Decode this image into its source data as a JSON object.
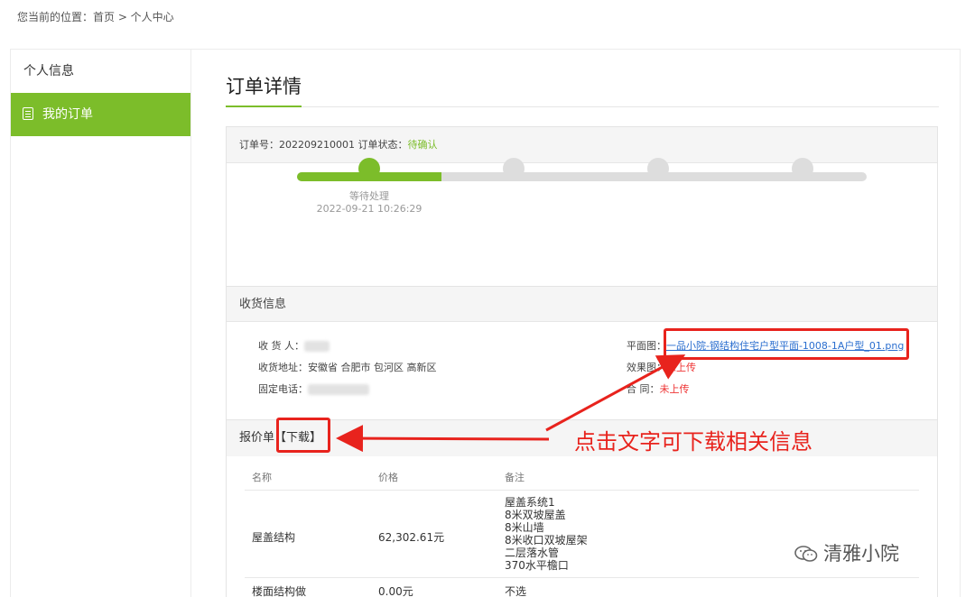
{
  "breadcrumb": "您当前的位置：首页 > 个人中心",
  "sidebar": {
    "items": [
      {
        "label": "个人信息",
        "active": false
      },
      {
        "label": "我的订单",
        "active": true
      }
    ]
  },
  "main": {
    "title": "订单详情"
  },
  "order": {
    "number_label": "订单号：202209210001  订单状态：",
    "status": "待确认",
    "progress": {
      "current_step": 1,
      "total_steps": 5,
      "step_label": "等待处理",
      "step_time": "2022-09-21 10:26:29"
    }
  },
  "delivery": {
    "title": "收货信息",
    "receiver_label": "收 货 人：",
    "address_label": "收货地址：",
    "address": "安徽省 合肥市 包河区 高新区",
    "phone_label": "固定电话：",
    "plan_label": "平面图：",
    "plan_file": "一品小院-钢结构住宅户型平面-1008-1A户型_01.png",
    "render_label": "效果图：",
    "render_status": "未上传",
    "contract_label": "合 同：",
    "contract_status": "未上传"
  },
  "quote": {
    "title": "报价单",
    "download": "【下载】",
    "columns": [
      "名称",
      "价格",
      "备注"
    ],
    "rows": [
      {
        "name": "屋盖结构",
        "price": "62,302.61元",
        "notes": [
          "屋盖系统1",
          "8米双坡屋盖",
          "8米山墙",
          "8米收口双坡屋架",
          "二层落水管",
          "370水平檐口"
        ]
      },
      {
        "name": "楼面结构做",
        "price": "0.00元",
        "notes": [
          "不选"
        ]
      }
    ]
  },
  "annotation": {
    "callout": "点击文字可下载相关信息"
  },
  "watermark": {
    "text": "清雅小院"
  },
  "colors": {
    "accent": "#7cbd2a",
    "annotation": "#e8231d",
    "link": "#2a6ecf"
  }
}
